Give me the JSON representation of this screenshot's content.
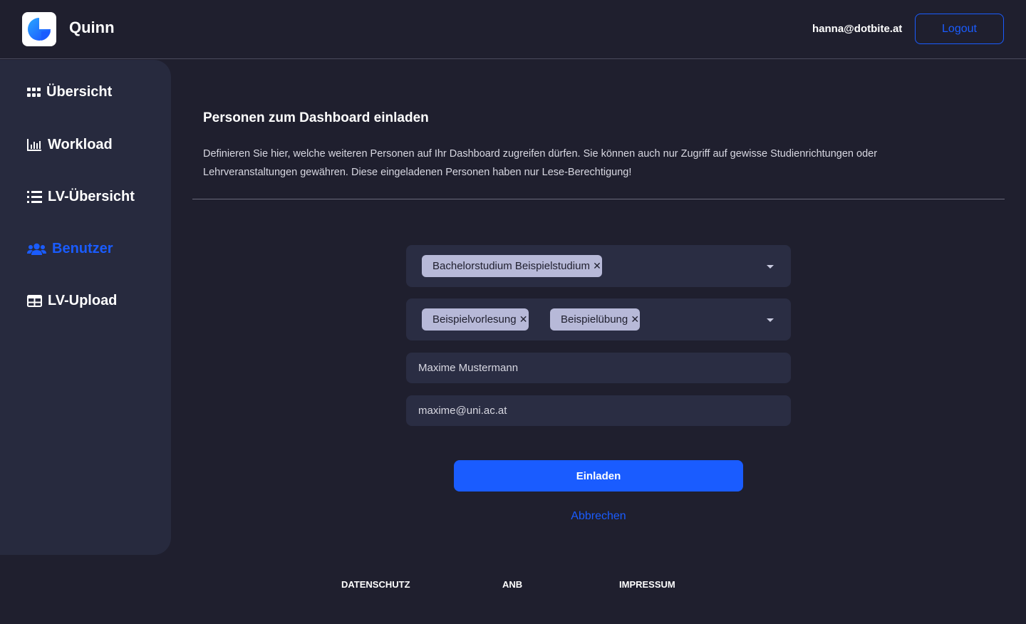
{
  "header": {
    "app_name": "Quinn",
    "user_email": "hanna@dotbite.at",
    "logout_label": "Logout"
  },
  "sidebar": {
    "items": [
      {
        "label": "Übersicht",
        "icon": "grid-icon",
        "active": false
      },
      {
        "label": "Workload",
        "icon": "bar-chart-icon",
        "active": false
      },
      {
        "label": "LV-Übersicht",
        "icon": "list-icon",
        "active": false
      },
      {
        "label": "Benutzer",
        "icon": "users-icon",
        "active": true
      },
      {
        "label": "LV-Upload",
        "icon": "table-icon",
        "active": false
      }
    ]
  },
  "main": {
    "title": "Personen zum Dashboard einladen",
    "description": "Definieren Sie hier, welche weiteren Personen auf Ihr Dashboard zugreifen dürfen. Sie können auch nur Zugriff auf gewisse Studienrichtungen oder Lehrveranstaltungen gewähren. Diese eingeladenen Personen haben nur Lese-Berechtigung!",
    "study_select": {
      "chips": [
        "Bachelorstudium Beispielstudium"
      ]
    },
    "course_select": {
      "chips": [
        "Beispielvorlesung",
        "Beispielübung"
      ]
    },
    "name_input": {
      "value": "Maxime Mustermann"
    },
    "email_input": {
      "value": "maxime@uni.ac.at"
    },
    "invite_label": "Einladen",
    "cancel_label": "Abbrechen"
  },
  "footer": {
    "links": [
      "DATENSCHUTZ",
      "ANB",
      "IMPRESSUM"
    ]
  },
  "colors": {
    "accent": "#1a5cff",
    "background": "#1f1f2e",
    "sidebar": "#272a3e",
    "field": "#2a2d43",
    "chip": "#b7b9d8"
  }
}
